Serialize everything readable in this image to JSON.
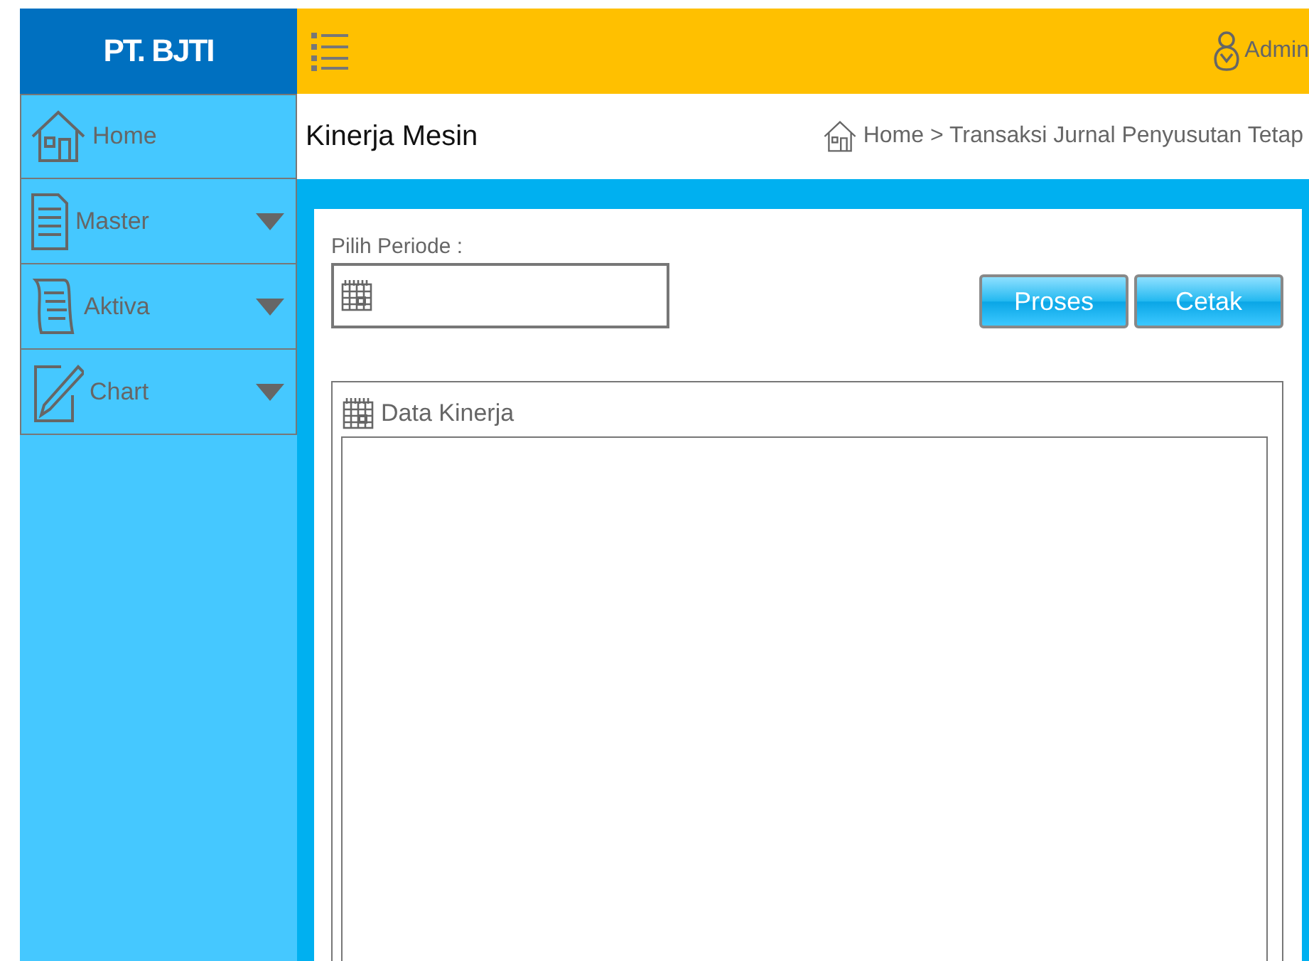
{
  "brand": "PT. BJTI",
  "user": "Admin",
  "sidebar": {
    "items": [
      {
        "label": "Home",
        "expandable": false
      },
      {
        "label": "Master",
        "expandable": true
      },
      {
        "label": "Aktiva",
        "expandable": true
      },
      {
        "label": "Chart",
        "expandable": true
      }
    ]
  },
  "page_title": "Kinerja Mesin",
  "breadcrumb": "Home > Transaksi Jurnal Penyusutan Tetap",
  "period": {
    "label": "Pilih Periode :"
  },
  "buttons": [
    "Proses",
    "Cetak"
  ],
  "data_panel": {
    "title": "Data Kinerja"
  }
}
